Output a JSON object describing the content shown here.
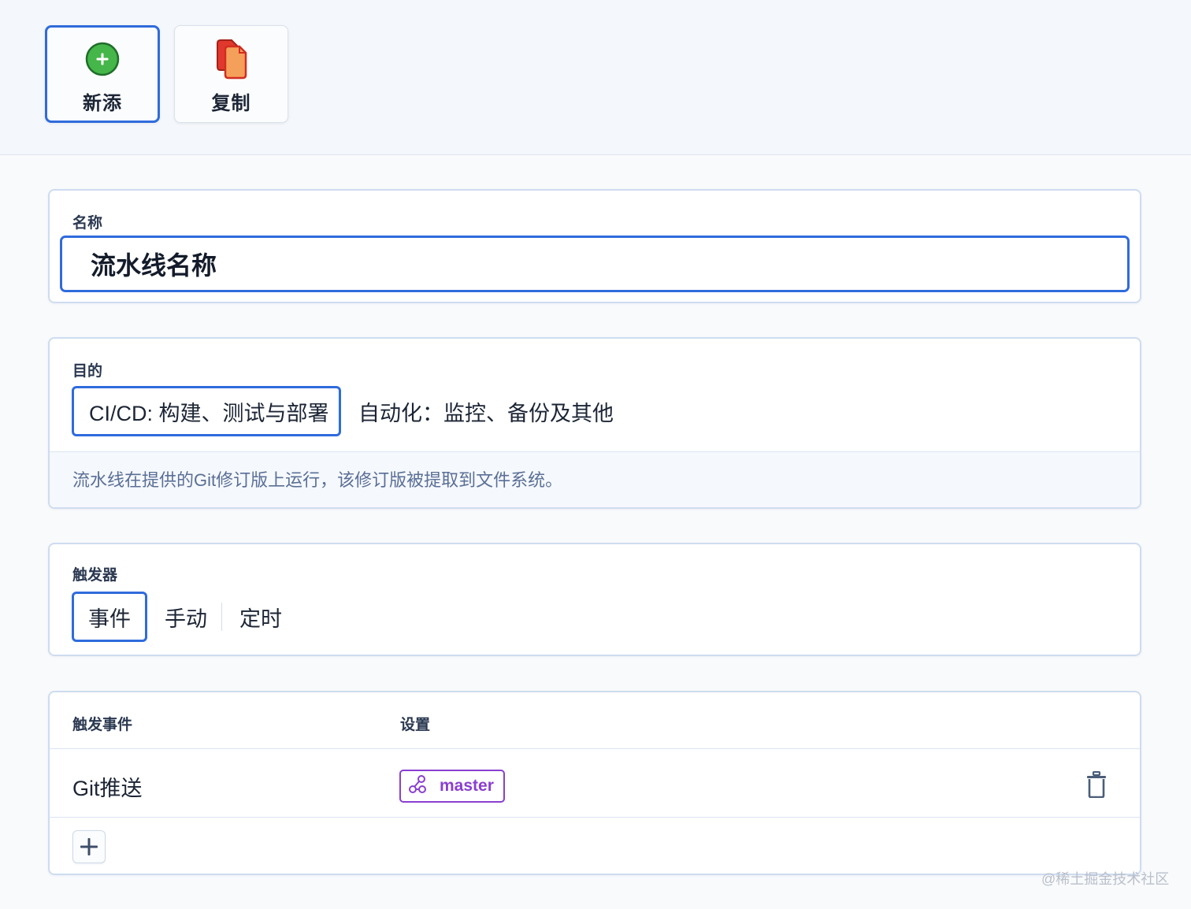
{
  "toolbar": {
    "new_label": "新添",
    "copy_label": "复制",
    "new_icon": "plus-circle-icon",
    "copy_icon": "copy-icon"
  },
  "name_section": {
    "label": "名称",
    "value": "流水线名称"
  },
  "purpose_section": {
    "label": "目的",
    "options": [
      {
        "label": "CI/CD: 构建、测试与部署",
        "selected": true
      },
      {
        "label": "自动化：监控、备份及其他",
        "selected": false
      }
    ],
    "description": "流水线在提供的Git修订版上运行，该修订版被提取到文件系统。"
  },
  "trigger_section": {
    "label": "触发器",
    "options": [
      {
        "label": "事件",
        "selected": true
      },
      {
        "label": "手动",
        "selected": false
      },
      {
        "label": "定时",
        "selected": false
      }
    ]
  },
  "events_section": {
    "col_event": "触发事件",
    "col_settings": "设置",
    "rows": [
      {
        "event": "Git推送",
        "branch": "master",
        "branch_icon": "git-branch-icon"
      }
    ]
  },
  "watermark": "@稀土掘金技术社区",
  "colors": {
    "accent": "#2f6bdc",
    "branch_tag": "#8a3fd0",
    "plus_green": "#45b649",
    "copy_red": "#e0382c",
    "copy_orange": "#f5a05a"
  }
}
